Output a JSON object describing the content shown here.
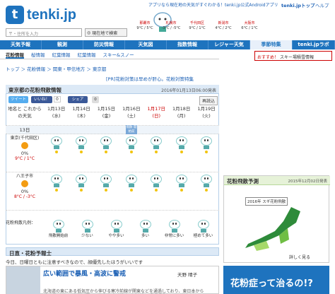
{
  "topbar": {
    "message": "アプリなら現在地の天気がすぐわかる！tenki.jp公式Androidアプリ",
    "top_link": "tenki.jpトップ",
    "help_link": "ヘルプ"
  },
  "logo": {
    "icon": "t",
    "text": "tenki.jp"
  },
  "search": {
    "placeholder": "〒・住所を入力",
    "current_button": "現在地で検索"
  },
  "cities": [
    {
      "name": "那覇市",
      "temp": "9°C / 5°C"
    },
    {
      "name": "札幌市",
      "temp": "-3°C / -5°C"
    },
    {
      "name": "千代田区",
      "temp": "9°C / 1°C"
    },
    {
      "name": "新潟市",
      "temp": "4°C / 2°C"
    },
    {
      "name": "大阪市",
      "temp": "6°C / 1°C"
    }
  ],
  "nav": [
    "天気予報",
    "観測",
    "防災情報",
    "天気図",
    "指数情報",
    "レジャー天気",
    "季節特集",
    "tenki.jpラボ"
  ],
  "subnav": [
    "花粉情報",
    "桜情報",
    "紅葉情報",
    "紅葉情報",
    "スキー&スノー"
  ],
  "right_ad": {
    "label": "おすすめ！",
    "text": "スキー場積雪情報"
  },
  "breadcrumb": "トップ ＞ 花粉情報 ＞ 関東・甲信地方 ＞ 東京都",
  "promo": "[PR]花粉対策は早めが肝心。花粉対策特集",
  "forecast": {
    "title": "東京都の花粉飛散情報",
    "issued": "2016年01月13日06:00発表",
    "tweet": "ツイート",
    "like": "いいね！",
    "share": "シェア",
    "like_count": "0",
    "reload": "再読込",
    "corner_label": "地名と これからの天気",
    "today": "13日",
    "dates": [
      "1月13日(水)",
      "1月14日(木)",
      "1月15日(金)",
      "1月16日(土)",
      "1月17日(日)",
      "1月18日(月)",
      "1月19日(火)"
    ],
    "season_label": "飛散 開始前",
    "places": [
      {
        "name": "東京(千代田区)",
        "pct": "0%",
        "temp": "9°C / 1°C"
      },
      {
        "name": "八王子市",
        "pct": "0%",
        "temp": "8°C / -3°C"
      }
    ],
    "legend_title": "花粉飛散凡例：",
    "legend": [
      "飛散開始前",
      "少ない",
      "やや多い",
      "多い",
      "非常に多い",
      "極めて多い"
    ]
  },
  "section": {
    "title": "日直・花粉予報士",
    "note": "今日、日曜日ともに注意すべきなので、顔優先したほうがいいです"
  },
  "news": {
    "headline": "広い範囲で暴風・高波に警戒",
    "author": "天野 晴子",
    "body": "北海道の東にある低気圧から伸びる寒冷前線が関東などを通過しており、東日本から"
  },
  "side_forecast": {
    "title": "花粉飛散予測",
    "date": "2015年12月02日発表",
    "map_title": "2016年 スギ花粉飛散",
    "link": "詳しく見る"
  },
  "side_ad": {
    "text": "花粉症って治るの!?"
  },
  "colors": {
    "brand": "#1e73be",
    "header_bg": "#dce9f6",
    "accent_red": "#cc0000"
  }
}
